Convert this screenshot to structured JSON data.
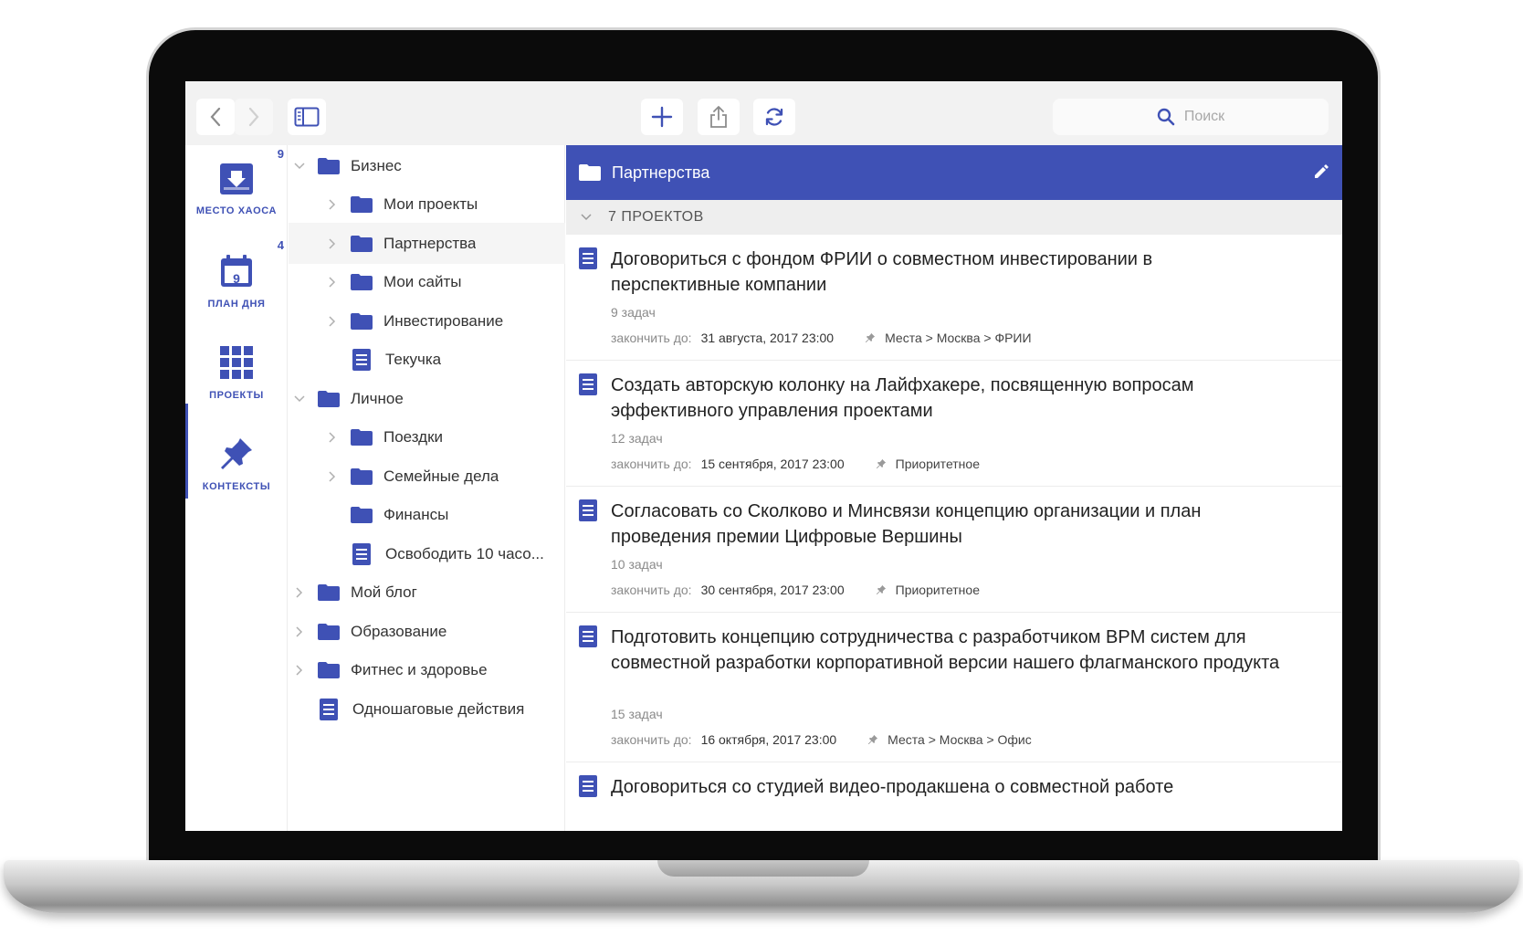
{
  "toolbar": {
    "search_placeholder": "Поиск"
  },
  "rail": {
    "items": [
      {
        "label": "МЕСТО ХАОСА",
        "count": "9"
      },
      {
        "label": "ПЛАН ДНЯ",
        "count": "4",
        "day": "9"
      },
      {
        "label": "ПРОЕКТЫ",
        "count": ""
      },
      {
        "label": "КОНТЕКСТЫ",
        "count": ""
      }
    ]
  },
  "tree": {
    "items": [
      {
        "label": "Бизнес"
      },
      {
        "label": "Мои проекты"
      },
      {
        "label": "Партнерства"
      },
      {
        "label": "Мои сайты"
      },
      {
        "label": "Инвестирование"
      },
      {
        "label": "Текучка"
      },
      {
        "label": "Личное"
      },
      {
        "label": "Поездки"
      },
      {
        "label": "Семейные дела"
      },
      {
        "label": "Финансы"
      },
      {
        "label": "Освободить 10 часо..."
      },
      {
        "label": "Мой блог"
      },
      {
        "label": "Образование"
      },
      {
        "label": "Фитнес и здоровье"
      },
      {
        "label": "Одношаговые действия"
      }
    ]
  },
  "main": {
    "title": "Партнерства",
    "count_label": "7 ПРОЕКТОВ",
    "due_label": "закончить до:",
    "projects": [
      {
        "title": "Договориться с фондом ФРИИ о совместном инвестировании в перспективные компании",
        "tasks": "9 задач",
        "due": "31 августа, 2017 23:00",
        "context": "Места > Москва > ФРИИ"
      },
      {
        "title": "Создать авторскую колонку на Лайфхакере, посвященную вопросам эффективного управления проектами",
        "tasks": "12 задач",
        "due": "15 сентября, 2017 23:00",
        "context": "Приоритетное"
      },
      {
        "title": "Согласовать со Сколково и Минсвязи концепцию организации и план проведения премии Цифровые Вершины",
        "tasks": "10 задач",
        "due": "30 сентября, 2017 23:00",
        "context": "Приоритетное"
      },
      {
        "title": "Подготовить концепцию сотрудничества с разработчиком BPM систем для совместной разработки корпоративной версии нашего флагманского продукта",
        "tasks": "15 задач",
        "due": "16 октября, 2017 23:00",
        "context": "Места > Москва > Офис"
      },
      {
        "title": "Договориться со студией видео-продакшена о совместной работе"
      }
    ]
  },
  "colors": {
    "accent": "#3f51b5",
    "toolbar_bg": "#f2f2f2",
    "subheader_bg": "#eeeeee"
  }
}
